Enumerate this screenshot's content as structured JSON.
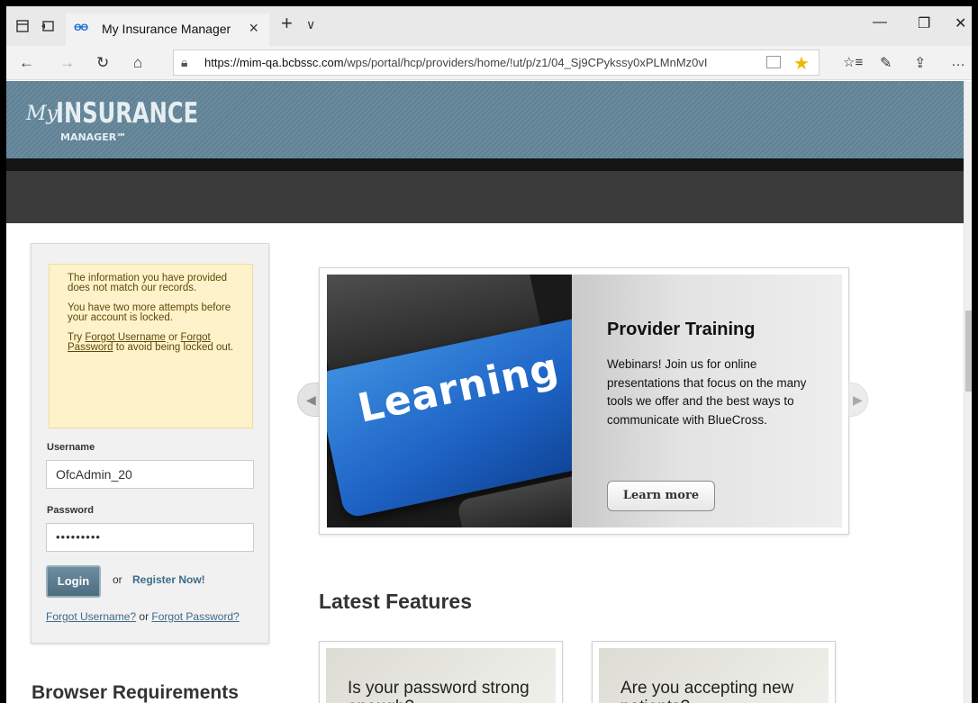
{
  "browser": {
    "tab_title": "My Insurance Manager",
    "tab_favicon": "ƟƟ",
    "url_host": "https://mim-qa.bcbssc.com",
    "url_path": "/wps/portal/hcp/providers/home/!ut/p/z1/04_Sj9CPykssy0xPLMnMz0vI"
  },
  "header": {
    "logo_my": "My",
    "logo_insurance": "INSURANCE",
    "logo_manager": "MANAGER℠"
  },
  "login": {
    "alert_line1": "The information you have provided does not match our records.",
    "alert_line2": "You have two more attempts before your account is locked.",
    "alert_try": "Try",
    "alert_forgot_username": "Forgot Username",
    "alert_or": "or",
    "alert_forgot_password": "Forgot Password",
    "alert_tail": "to avoid being locked out.",
    "username_label": "Username",
    "username_value": "OfcAdmin_20",
    "password_label": "Password",
    "password_value": "•••••••••",
    "login_button": "Login",
    "or_text": "or",
    "register_link": "Register Now!",
    "forgot_username_link": "Forgot Username?",
    "forgot_or": "or",
    "forgot_password_link": "Forgot Password?"
  },
  "browser_requirements": "Browser Requirements",
  "carousel": {
    "image_text": "Learning",
    "title": "Provider Training",
    "description": "Webinars! Join us for online presentations that focus on the many tools we offer and the best ways to communicate with BlueCross.",
    "button": "Learn more"
  },
  "latest": {
    "heading": "Latest Features",
    "cards": [
      {
        "title": "Is your password strong enough?"
      },
      {
        "title": "Are you accepting new patients?"
      }
    ]
  },
  "colors": {
    "banner": "#6a8c9e",
    "alert_bg": "#fdf2c9",
    "link": "#3d6a8a",
    "star": "#f2b600"
  }
}
